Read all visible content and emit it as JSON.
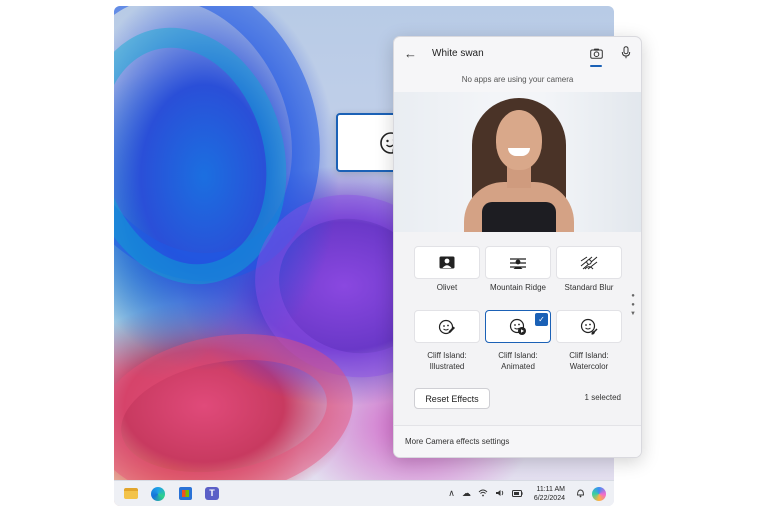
{
  "panel": {
    "title": "White swan",
    "status": "No apps are using your camera",
    "footer_link": "More Camera effects settings",
    "reset_label": "Reset Effects",
    "selected_count": "1 selected"
  },
  "effects": [
    {
      "line1": "Olivet",
      "line2": "",
      "icon": "person-portrait-icon",
      "selected": false
    },
    {
      "line1": "Mountain Ridge",
      "line2": "",
      "icon": "background-blur-icon",
      "selected": false
    },
    {
      "line1": "Standard Blur",
      "line2": "",
      "icon": "standard-blur-icon",
      "selected": false
    },
    {
      "line1": "Cliff Island:",
      "line2": "Illustrated",
      "icon": "face-pencil-icon",
      "selected": false
    },
    {
      "line1": "Cliff Island:",
      "line2": "Animated",
      "icon": "face-play-icon",
      "selected": true
    },
    {
      "line1": "Cliff Island:",
      "line2": "Watercolor",
      "icon": "face-brush-icon",
      "selected": false
    }
  ],
  "taskbar": {
    "time": "11:11 AM",
    "date": "6/22/2024",
    "apps": [
      "file-explorer-icon",
      "edge-icon",
      "store-icon",
      "teams-icon"
    ]
  },
  "colors": {
    "accent": "#1b61b6"
  }
}
